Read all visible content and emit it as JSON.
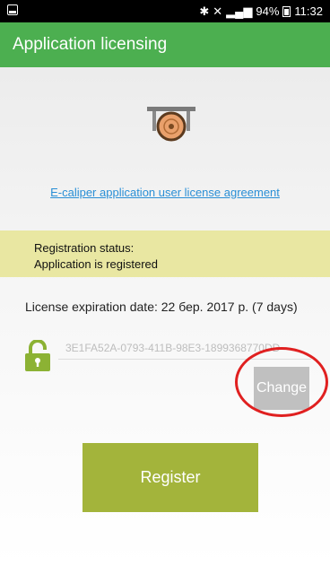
{
  "status_bar": {
    "icons": [
      "screenshot-icon",
      "bluetooth-icon",
      "mute-icon",
      "signal-icon",
      "battery-icon"
    ],
    "battery": "94%",
    "time": "11:32"
  },
  "app_bar": {
    "title": "Application licensing",
    "color": "#4caf50"
  },
  "main": {
    "logo_icon": "caliper-logo-icon",
    "agreement_link": "E-caliper application user license agreement",
    "registration": {
      "label": "Registration status:",
      "value": "Application is registered",
      "panel_color": "#e9e7a2"
    },
    "expiration": "License expiration date: 22 бер. 2017 р. (7 days)",
    "lock_icon": "unlock-icon",
    "license_key": "3E1FA52A-0793-411B-98E3-1899368770DD",
    "change_button": "Change",
    "register_button": "Register",
    "accent_colors": {
      "register": "#a3b43b",
      "link": "#2a8fd6",
      "annotation": "#e02020"
    }
  }
}
